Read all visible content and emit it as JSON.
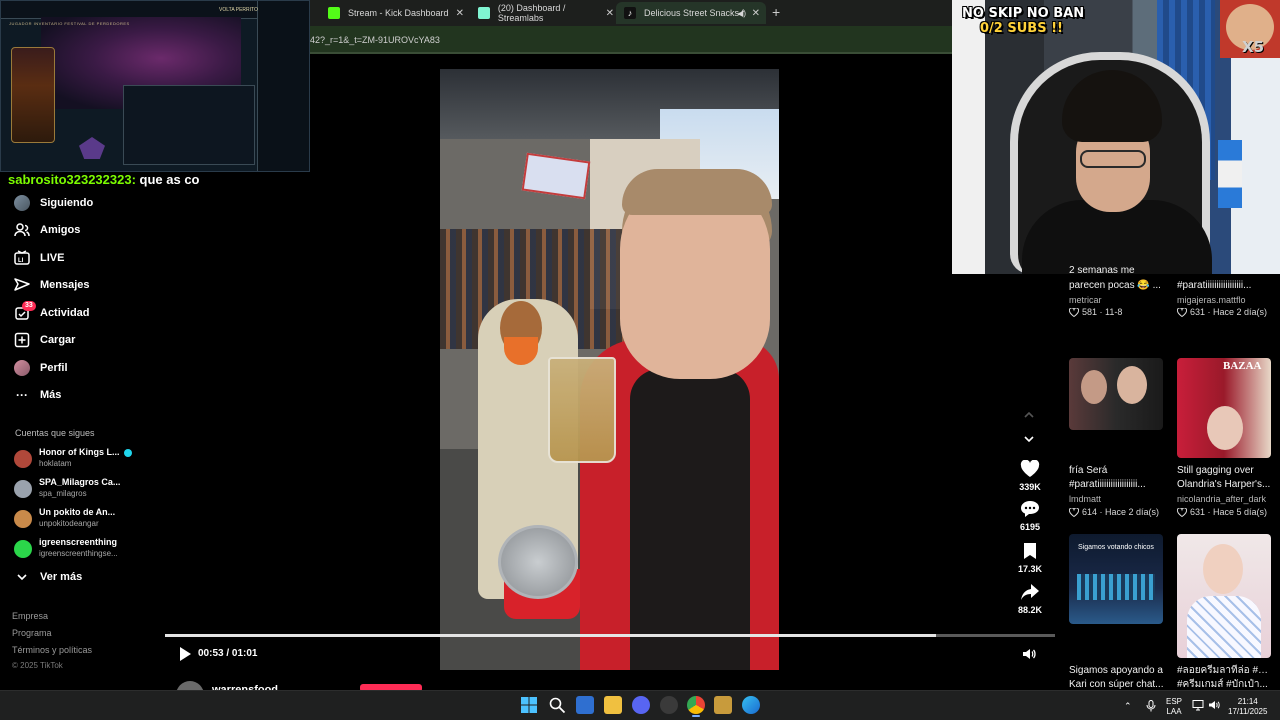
{
  "browser": {
    "tabs": [
      {
        "label": "Stream - Kick Dashboard",
        "icon_color": "#53fc18",
        "active": false
      },
      {
        "label": "(20) Dashboard / Streamlabs",
        "icon_color": "#80f5d2",
        "active": false
      },
      {
        "label": "Delicious Street Snacks for",
        "icon_color": "#ffffff",
        "active": true
      }
    ],
    "address_fragment": "42?_r=1&_t=ZM-91UROVcYA83"
  },
  "chat": {
    "username": "sabrosito323232323:",
    "message": " que as co"
  },
  "sidebar": {
    "nav": [
      {
        "label": "Siguiendo",
        "icon": "avatar",
        "badge": ""
      },
      {
        "label": "Amigos",
        "icon": "friends-icon",
        "badge": ""
      },
      {
        "label": "LIVE",
        "icon": "live-icon",
        "badge": ""
      },
      {
        "label": "Mensajes",
        "icon": "messages-icon",
        "badge": ""
      },
      {
        "label": "Actividad",
        "icon": "activity-icon",
        "badge": "33"
      },
      {
        "label": "Cargar",
        "icon": "upload-icon",
        "badge": ""
      },
      {
        "label": "Perfil",
        "icon": "avatar",
        "badge": ""
      },
      {
        "label": "Más",
        "icon": "more-icon",
        "badge": ""
      }
    ],
    "following_heading": "Cuentas que sigues",
    "following": [
      {
        "name": "Honor of Kings L...",
        "user": "hoklatam",
        "verified": true,
        "avatar_color": "#b0483a"
      },
      {
        "name": "SPA_Milagros Ca...",
        "user": "spa_milagros",
        "verified": false,
        "avatar_color": "#9aa2ad"
      },
      {
        "name": "Un pokito de An...",
        "user": "unpokitodeangar",
        "verified": false,
        "avatar_color": "#c98a4a"
      },
      {
        "name": "igreenscreenthing",
        "user": "igreenscreenthingse...",
        "verified": false,
        "avatar_color": "#2bd64a"
      }
    ],
    "see_more": "Ver más",
    "footer_links": [
      "Empresa",
      "Programa",
      "Términos y políticas"
    ],
    "copyright": "© 2025 TikTok"
  },
  "player": {
    "time": "00:53 / 01:01",
    "progress": 0.866,
    "author": "warrensfood"
  },
  "actions": [
    {
      "name": "like",
      "count": "339K"
    },
    {
      "name": "comment",
      "count": "6195"
    },
    {
      "name": "bookmark",
      "count": "17.3K"
    },
    {
      "name": "share",
      "count": "88.2K"
    }
  ],
  "webcam": {
    "overlay_title": "NO SKIP NO BAN",
    "overlay_subs": "0/2 SUBS !!",
    "sticker_text": "X5"
  },
  "feed": [
    {
      "title": "2 semanas me",
      "title2": "parecen pocas 😂 ...",
      "author": "metricar",
      "likes": "581",
      "date": "11-8"
    },
    {
      "title": "#paratiiiiiiiiiiiiiiiii...",
      "title2": "",
      "author": "migajeras.mattflo",
      "likes": "631",
      "date": "Hace 2 día(s)"
    },
    {
      "title": "fría Será",
      "title2": "#paratiiiiiiiiiiiiiiiiii...",
      "author": "lmdmatt",
      "likes": "614",
      "date": "Hace 2 día(s)"
    },
    {
      "title": "Still gagging over",
      "title2": "Olandria's Harper's...",
      "author": "nicolandria_after_dark",
      "likes": "631",
      "date": "Hace 5 día(s)"
    },
    {
      "title": "Sigamos apoyando a",
      "title2": "Kari con súper chat...",
      "author": "",
      "likes": "",
      "date": "",
      "thumb_text": "Sigamos votando chicos"
    },
    {
      "title": "#ลอยครีมลาทีล่อ #bbg",
      "title2": "#ครีมเกมส์ #บักเป๋า...",
      "author": "",
      "likes": "",
      "date": ""
    }
  ],
  "game_overlay": {
    "tabs": "JUGADOR   INVENTARIO   FESTIVAL DE PERDEDORES",
    "status": "VOLTA PERRITO"
  },
  "taskbar": {
    "lang_top": "ESP",
    "lang_bottom": "LAA",
    "time": "21:14",
    "date": "17/11/2025"
  }
}
